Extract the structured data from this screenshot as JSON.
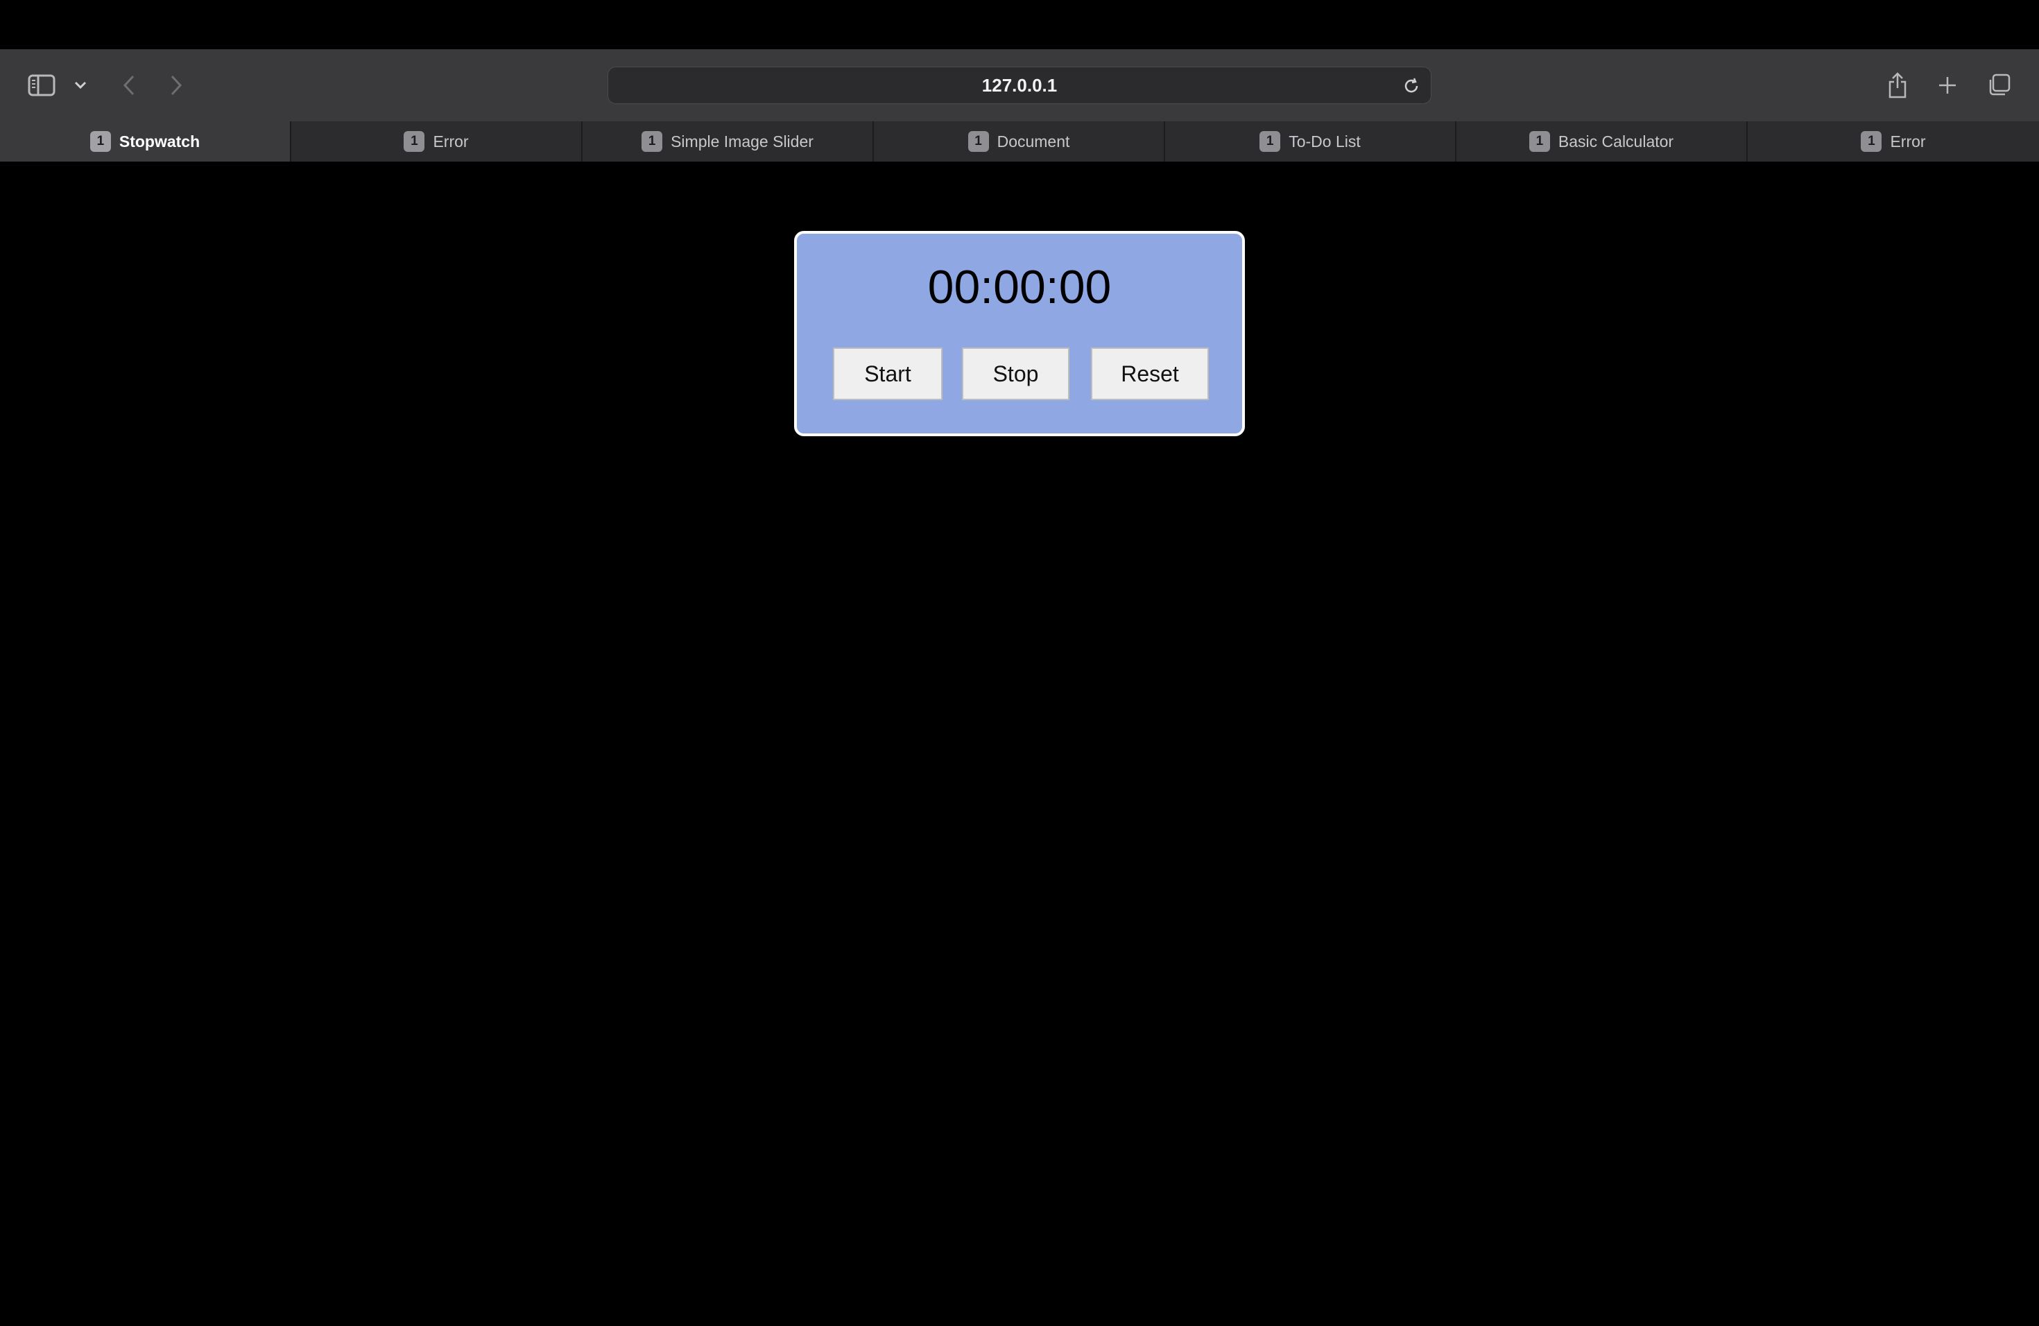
{
  "browser": {
    "address": "127.0.0.1",
    "tabs": [
      {
        "badge": "1",
        "title": "Stopwatch",
        "active": true
      },
      {
        "badge": "1",
        "title": "Error",
        "active": false
      },
      {
        "badge": "1",
        "title": "Simple Image Slider",
        "active": false
      },
      {
        "badge": "1",
        "title": "Document",
        "active": false
      },
      {
        "badge": "1",
        "title": "To-Do List",
        "active": false
      },
      {
        "badge": "1",
        "title": "Basic Calculator",
        "active": false
      },
      {
        "badge": "1",
        "title": "Error",
        "active": false
      }
    ]
  },
  "stopwatch": {
    "time": "00:00:00",
    "start_label": "Start",
    "stop_label": "Stop",
    "reset_label": "Reset",
    "panel_color": "#8fa8e4"
  }
}
